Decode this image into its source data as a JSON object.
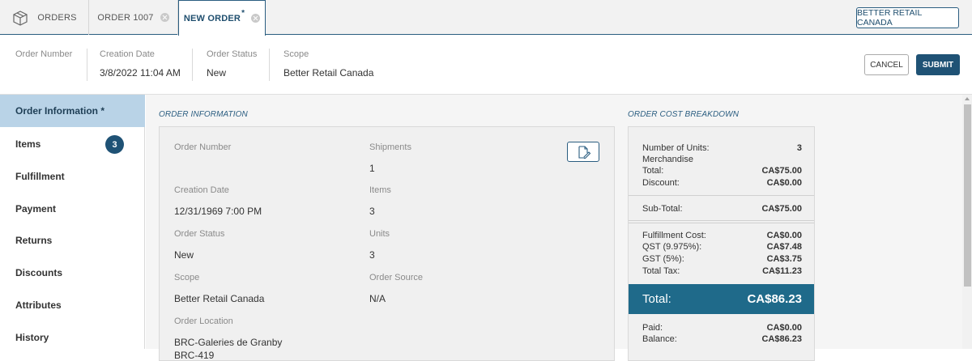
{
  "tabs": [
    {
      "label": "ORDERS",
      "icon": "box-icon"
    },
    {
      "label": "ORDER 1007",
      "icon": "close-icon"
    },
    {
      "label": "NEW ORDER",
      "modified_marker": "*",
      "icon": "close-icon"
    }
  ],
  "retail_button": "BETTER RETAIL CANADA",
  "header": {
    "order_number": {
      "label": "Order Number",
      "value": ""
    },
    "creation_date": {
      "label": "Creation Date",
      "value": "3/8/2022 11:04 AM"
    },
    "order_status": {
      "label": "Order Status",
      "value": "New"
    },
    "scope": {
      "label": "Scope",
      "value": "Better Retail Canada"
    },
    "cancel_label": "CANCEL",
    "submit_label": "SUBMIT"
  },
  "sidebar": {
    "items": [
      {
        "label": "Order Information *"
      },
      {
        "label": "Items",
        "badge": "3"
      },
      {
        "label": "Fulfillment"
      },
      {
        "label": "Payment"
      },
      {
        "label": "Returns"
      },
      {
        "label": "Discounts"
      },
      {
        "label": "Attributes"
      },
      {
        "label": "History"
      }
    ]
  },
  "order_info": {
    "title": "ORDER INFORMATION",
    "fields": {
      "order_number": {
        "label": "Order Number",
        "value": ""
      },
      "shipments": {
        "label": "Shipments",
        "value": "1"
      },
      "creation_date": {
        "label": "Creation Date",
        "value": "12/31/1969 7:00 PM"
      },
      "items": {
        "label": "Items",
        "value": "3"
      },
      "order_status": {
        "label": "Order Status",
        "value": "New"
      },
      "units": {
        "label": "Units",
        "value": "3"
      },
      "scope": {
        "label": "Scope",
        "value": "Better Retail Canada"
      },
      "order_source": {
        "label": "Order Source",
        "value": "N/A"
      },
      "order_location": {
        "label": "Order Location",
        "value": "BRC-Galeries de Granby",
        "value2": "BRC-419"
      }
    }
  },
  "cost_breakdown": {
    "title": "ORDER COST BREAKDOWN",
    "number_of_units": {
      "label": "Number of Units:",
      "value": "3"
    },
    "merchandise_label": "Merchandise",
    "merchandise_total": {
      "label": "Total:",
      "value": "CA$75.00"
    },
    "discount": {
      "label": "Discount:",
      "value": "CA$0.00"
    },
    "subtotal": {
      "label": "Sub-Total:",
      "value": "CA$75.00"
    },
    "fulfillment_cost": {
      "label": "Fulfillment Cost:",
      "value": "CA$0.00"
    },
    "qst": {
      "label": "QST (9.975%):",
      "value": "CA$7.48"
    },
    "gst": {
      "label": "GST (5%):",
      "value": "CA$3.75"
    },
    "total_tax": {
      "label": "Total Tax:",
      "value": "CA$11.23"
    },
    "total": {
      "label": "Total:",
      "value": "CA$86.23"
    },
    "paid": {
      "label": "Paid:",
      "value": "CA$0.00"
    },
    "balance": {
      "label": "Balance:",
      "value": "CA$86.23"
    }
  },
  "colors": {
    "primary": "#1f5275",
    "active_nav": "#b9d3e7",
    "total_bar": "#1f6a8a"
  }
}
